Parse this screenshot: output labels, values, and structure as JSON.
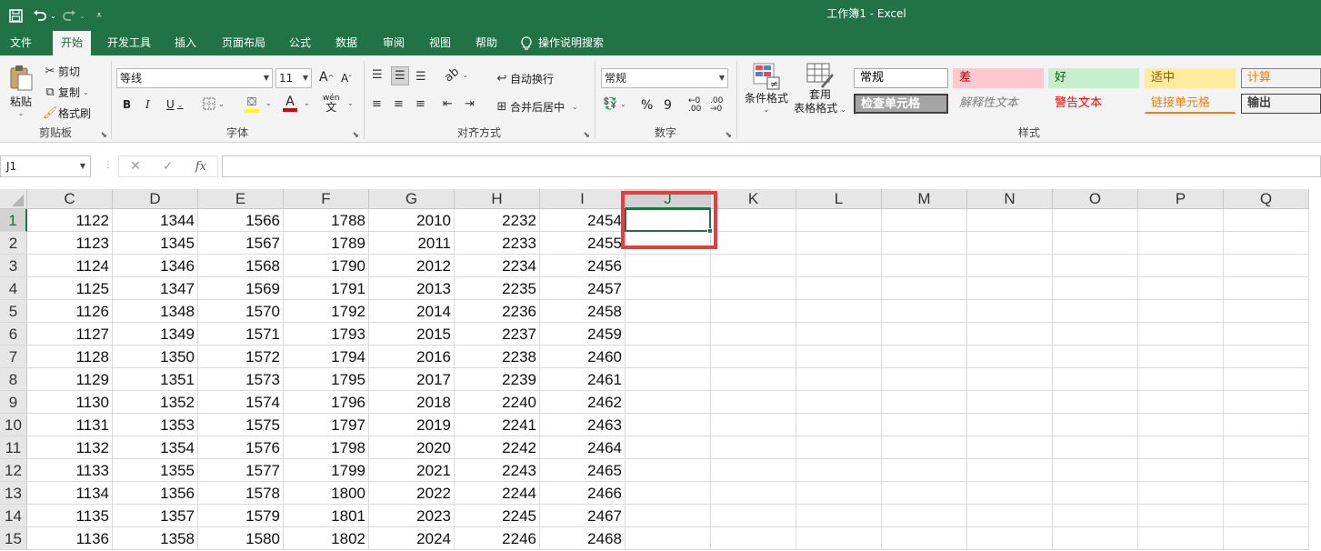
{
  "titlebar": {
    "title": "工作簿1  -  Excel",
    "save_icon": "save-icon",
    "undo_icon": "undo-icon",
    "redo_icon": "redo-icon",
    "customize_icon": "customize-qat-icon"
  },
  "tabs": [
    {
      "label": "文件",
      "active": false
    },
    {
      "label": "开始",
      "active": true
    },
    {
      "label": "开发工具",
      "active": false
    },
    {
      "label": "插入",
      "active": false
    },
    {
      "label": "页面布局",
      "active": false
    },
    {
      "label": "公式",
      "active": false
    },
    {
      "label": "数据",
      "active": false
    },
    {
      "label": "审阅",
      "active": false
    },
    {
      "label": "视图",
      "active": false
    },
    {
      "label": "帮助",
      "active": false
    }
  ],
  "tell_me": "操作说明搜索",
  "ribbon": {
    "clipboard": {
      "label": "剪贴板",
      "paste": "粘贴",
      "cut": "剪切",
      "copy": "复制",
      "format_painter": "格式刷"
    },
    "font": {
      "label": "字体",
      "font_name": "等线",
      "font_size": "11",
      "grow": "A",
      "shrink": "A",
      "bold": "B",
      "italic": "I",
      "underline": "U",
      "font_color_letter": "A",
      "phonetic_top": "wén",
      "phonetic_bottom": "文"
    },
    "alignment": {
      "label": "对齐方式",
      "wrap_text": "自动换行",
      "merge_center": "合并后居中"
    },
    "number": {
      "label": "数字",
      "format": "常规",
      "percent": "%",
      "comma": "9"
    },
    "styles": {
      "label": "样式",
      "conditional_format": "条件格式",
      "format_table_1": "套用",
      "format_table_2": "表格格式",
      "cells": [
        {
          "text": "常规",
          "bg": "#ffffff",
          "color": "#000000",
          "border": "#a6a6a6"
        },
        {
          "text": "差",
          "bg": "#ffc7ce",
          "color": "#9c0006",
          "border": "transparent"
        },
        {
          "text": "好",
          "bg": "#c6efce",
          "color": "#006100",
          "border": "transparent"
        },
        {
          "text": "适中",
          "bg": "#ffeb9c",
          "color": "#9c5700",
          "border": "transparent"
        },
        {
          "text": "计算",
          "bg": "#f2f2f2",
          "color": "#fa7d00",
          "border": "#7f7f7f"
        },
        {
          "text": "检查单元格",
          "bg": "#a5a5a5",
          "color": "#ffffff",
          "border": "#3f3f3f"
        },
        {
          "text": "解释性文本",
          "bg": "transparent",
          "color": "#7f7f7f",
          "border": "transparent"
        },
        {
          "text": "警告文本",
          "bg": "transparent",
          "color": "#ff0000",
          "border": "transparent"
        },
        {
          "text": "链接单元格",
          "bg": "transparent",
          "color": "#fa7d00",
          "border": "transparent"
        },
        {
          "text": "输出",
          "bg": "#f2f2f2",
          "color": "#3f3f3f",
          "border": "#3f3f3f"
        }
      ]
    }
  },
  "formula_bar": {
    "name_box": "J1",
    "cancel": "✕",
    "enter": "✓",
    "fx": "fx",
    "value": ""
  },
  "grid": {
    "columns": [
      "C",
      "D",
      "E",
      "F",
      "G",
      "H",
      "I",
      "J",
      "K",
      "L",
      "M",
      "N",
      "O",
      "P",
      "Q"
    ],
    "selected_column": "J",
    "rows": [
      "1",
      "2",
      "3",
      "4",
      "5",
      "6",
      "7",
      "8",
      "9",
      "10",
      "11",
      "12",
      "13",
      "14",
      "15"
    ],
    "selected_row": "1",
    "data": [
      [
        "1122",
        "1344",
        "1566",
        "1788",
        "2010",
        "2232",
        "2454"
      ],
      [
        "1123",
        "1345",
        "1567",
        "1789",
        "2011",
        "2233",
        "2455"
      ],
      [
        "1124",
        "1346",
        "1568",
        "1790",
        "2012",
        "2234",
        "2456"
      ],
      [
        "1125",
        "1347",
        "1569",
        "1791",
        "2013",
        "2235",
        "2457"
      ],
      [
        "1126",
        "1348",
        "1570",
        "1792",
        "2014",
        "2236",
        "2458"
      ],
      [
        "1127",
        "1349",
        "1571",
        "1793",
        "2015",
        "2237",
        "2459"
      ],
      [
        "1128",
        "1350",
        "1572",
        "1794",
        "2016",
        "2238",
        "2460"
      ],
      [
        "1129",
        "1351",
        "1573",
        "1795",
        "2017",
        "2239",
        "2461"
      ],
      [
        "1130",
        "1352",
        "1574",
        "1796",
        "2018",
        "2240",
        "2462"
      ],
      [
        "1131",
        "1353",
        "1575",
        "1797",
        "2019",
        "2241",
        "2463"
      ],
      [
        "1132",
        "1354",
        "1576",
        "1798",
        "2020",
        "2242",
        "2464"
      ],
      [
        "1133",
        "1355",
        "1577",
        "1799",
        "2021",
        "2243",
        "2465"
      ],
      [
        "1134",
        "1356",
        "1578",
        "1800",
        "2022",
        "2244",
        "2466"
      ],
      [
        "1135",
        "1357",
        "1579",
        "1801",
        "2023",
        "2245",
        "2467"
      ],
      [
        "1136",
        "1358",
        "1580",
        "1802",
        "2024",
        "2246",
        "2468"
      ]
    ]
  },
  "colors": {
    "excel_green": "#217346",
    "highlight_red": "#e53e3e"
  }
}
